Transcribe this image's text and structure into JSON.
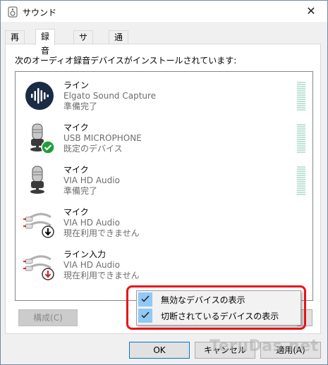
{
  "window": {
    "title": "サウンド",
    "close_glyph": "✕"
  },
  "tabs": [
    {
      "label": "再生",
      "active": false
    },
    {
      "label": "録音",
      "active": true
    },
    {
      "label": "サウンド",
      "active": false
    },
    {
      "label": "通信",
      "active": false
    }
  ],
  "description": "次のオーディオ録音デバイスがインストールされています:",
  "devices": [
    {
      "name": "ライン",
      "product": "Elgato Sound Capture",
      "status": "準備完了",
      "icon": "elgato-waveform-icon",
      "meter": true
    },
    {
      "name": "マイク",
      "product": "USB MICROPHONE",
      "status": "既定のデバイス",
      "icon": "microphone-default-icon",
      "meter": true
    },
    {
      "name": "マイク",
      "product": "VIA HD Audio",
      "status": "準備完了",
      "icon": "microphone-icon",
      "meter": true
    },
    {
      "name": "マイク",
      "product": "VIA HD Audio",
      "status": "現在利用できません",
      "icon": "audio-jack-unplugged-icon",
      "meter": false
    },
    {
      "name": "ライン入力",
      "product": "VIA HD Audio",
      "status": "現在利用できません",
      "icon": "audio-jack-unplugged-red-icon",
      "meter": false
    }
  ],
  "buttons": {
    "configure": "構成(C)",
    "ok": "OK",
    "cancel": "キャンセル",
    "apply": "適用(A)"
  },
  "context_menu": [
    {
      "label": "無効なデバイスの表示",
      "checked": true
    },
    {
      "label": "切断されているデバイスの表示",
      "checked": true
    }
  ],
  "watermark": "TeruDas.net",
  "colors": {
    "accent": "#0078d7",
    "check_bg": "#90c8f6",
    "highlight": "#e8141c",
    "default_badge": "#1e9e3a"
  }
}
